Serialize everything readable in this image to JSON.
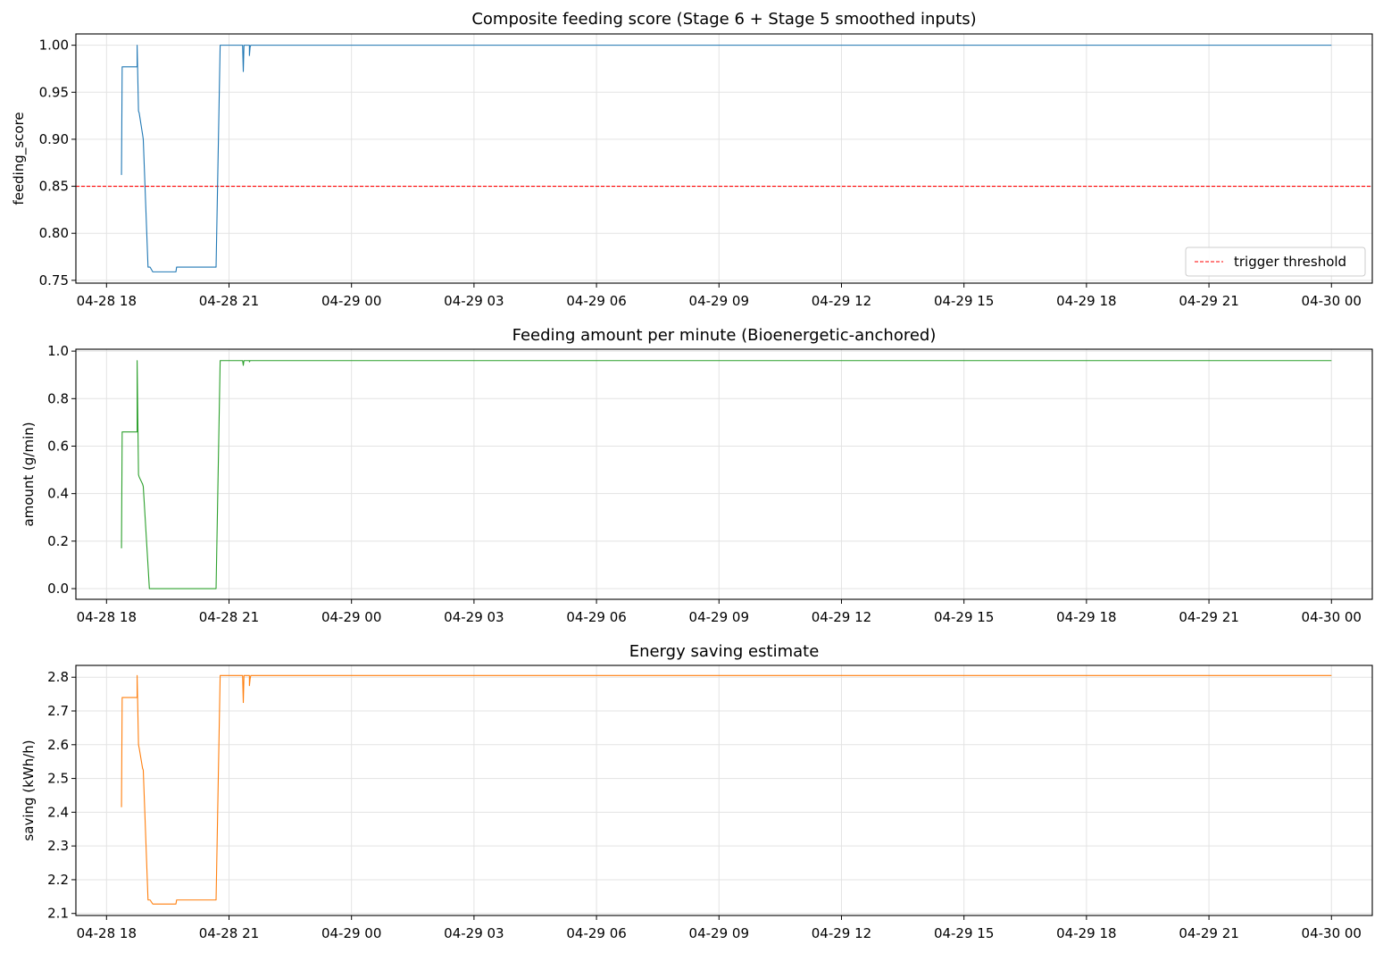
{
  "chart_data": [
    {
      "type": "line",
      "title": "Composite feeding score (Stage 6 + Stage 5 smoothed inputs)",
      "xlabel": "",
      "ylabel": "feeding_score",
      "xlim": [
        "2026-04-28 17:15",
        "2026-04-30 01:00"
      ],
      "ylim": [
        0.747,
        1.012
      ],
      "x_ticks": [
        "04-28 18",
        "04-28 21",
        "04-29 00",
        "04-29 03",
        "04-29 06",
        "04-29 09",
        "04-29 12",
        "04-29 15",
        "04-29 18",
        "04-29 21",
        "04-30 00"
      ],
      "y_ticks": [
        "0.75",
        "0.80",
        "0.85",
        "0.90",
        "0.95",
        "1.00"
      ],
      "grid": true,
      "legend_position": "lower right",
      "reference_lines": [
        {
          "name": "trigger threshold",
          "y": 0.85,
          "color": "#ff0000",
          "style": "dashed"
        }
      ],
      "series": [
        {
          "color": "#1f77b4",
          "x": [
            "2026-04-28 18:22",
            "2026-04-28 18:23",
            "2026-04-28 18:45",
            "2026-04-28 18:45",
            "2026-04-28 18:45",
            "2026-04-28 18:47",
            "2026-04-28 18:48",
            "2026-04-28 18:53",
            "2026-04-28 18:54",
            "2026-04-28 19:01",
            "2026-04-28 19:04",
            "2026-04-28 19:08",
            "2026-04-28 19:42",
            "2026-04-28 19:43",
            "2026-04-28 20:41",
            "2026-04-28 20:47",
            "2026-04-28 21:20",
            "2026-04-28 21:21",
            "2026-04-28 21:22",
            "2026-04-28 21:30",
            "2026-04-28 21:30",
            "2026-04-28 21:31",
            "2026-04-28 21:32",
            "2026-04-30 00:00"
          ],
          "y": [
            0.862,
            0.977,
            0.977,
            0.977,
            1.0,
            0.93,
            0.928,
            0.905,
            0.9,
            0.764,
            0.764,
            0.759,
            0.759,
            0.764,
            0.764,
            1.0,
            1.0,
            0.972,
            1.0,
            1.0,
            0.989,
            0.998,
            1.0,
            1.0
          ]
        }
      ]
    },
    {
      "type": "line",
      "title": "Feeding amount per minute (Bioenergetic-anchored)",
      "xlabel": "",
      "ylabel": "amount (g/min)",
      "xlim": [
        "2026-04-28 17:15",
        "2026-04-30 01:00"
      ],
      "ylim": [
        -0.045,
        1.008
      ],
      "x_ticks": [
        "04-28 18",
        "04-28 21",
        "04-29 00",
        "04-29 03",
        "04-29 06",
        "04-29 09",
        "04-29 12",
        "04-29 15",
        "04-29 18",
        "04-29 21",
        "04-30 00"
      ],
      "y_ticks": [
        "0.0",
        "0.2",
        "0.4",
        "0.6",
        "0.8",
        "1.0"
      ],
      "grid": true,
      "series": [
        {
          "color": "#2ca02c",
          "x": [
            "2026-04-28 18:22",
            "2026-04-28 18:23",
            "2026-04-28 18:44",
            "2026-04-28 18:45",
            "2026-04-28 18:45",
            "2026-04-28 18:47",
            "2026-04-28 18:48",
            "2026-04-28 18:53",
            "2026-04-28 18:54",
            "2026-04-28 19:03",
            "2026-04-28 19:04",
            "2026-04-28 20:41",
            "2026-04-28 20:47",
            "2026-04-28 21:20",
            "2026-04-28 21:21",
            "2026-04-28 21:22",
            "2026-04-28 21:30",
            "2026-04-28 21:30",
            "2026-04-28 21:31",
            "2026-04-28 21:32",
            "2026-04-30 00:00"
          ],
          "y": [
            0.17,
            0.66,
            0.66,
            0.66,
            0.96,
            0.48,
            0.47,
            0.44,
            0.43,
            0.0,
            0.0,
            0.0,
            0.96,
            0.96,
            0.94,
            0.96,
            0.96,
            0.955,
            0.96,
            0.96,
            0.96
          ]
        }
      ]
    },
    {
      "type": "line",
      "title": "Energy saving estimate",
      "xlabel": "",
      "ylabel": "saving (kWh/h)",
      "xlim": [
        "2026-04-28 17:15",
        "2026-04-30 01:00"
      ],
      "ylim": [
        2.094,
        2.835
      ],
      "x_ticks": [
        "04-28 18",
        "04-28 21",
        "04-29 00",
        "04-29 03",
        "04-29 06",
        "04-29 09",
        "04-29 12",
        "04-29 15",
        "04-29 18",
        "04-29 21",
        "04-30 00"
      ],
      "y_ticks": [
        "2.1",
        "2.2",
        "2.3",
        "2.4",
        "2.5",
        "2.6",
        "2.7",
        "2.8"
      ],
      "grid": true,
      "series": [
        {
          "color": "#ff7f0e",
          "x": [
            "2026-04-28 18:22",
            "2026-04-28 18:23",
            "2026-04-28 18:44",
            "2026-04-28 18:45",
            "2026-04-28 18:45",
            "2026-04-28 18:47",
            "2026-04-28 18:48",
            "2026-04-28 18:53",
            "2026-04-28 18:54",
            "2026-04-28 19:01",
            "2026-04-28 19:04",
            "2026-04-28 19:08",
            "2026-04-28 19:42",
            "2026-04-28 19:43",
            "2026-04-28 20:41",
            "2026-04-28 20:47",
            "2026-04-28 21:20",
            "2026-04-28 21:21",
            "2026-04-28 21:22",
            "2026-04-28 21:30",
            "2026-04-28 21:30",
            "2026-04-28 21:31",
            "2026-04-28 21:32",
            "2026-04-30 00:00"
          ],
          "y": [
            2.415,
            2.74,
            2.74,
            2.74,
            2.805,
            2.6,
            2.59,
            2.53,
            2.525,
            2.14,
            2.14,
            2.128,
            2.128,
            2.14,
            2.14,
            2.805,
            2.805,
            2.725,
            2.805,
            2.805,
            2.775,
            2.795,
            2.805,
            2.805
          ]
        }
      ]
    }
  ]
}
